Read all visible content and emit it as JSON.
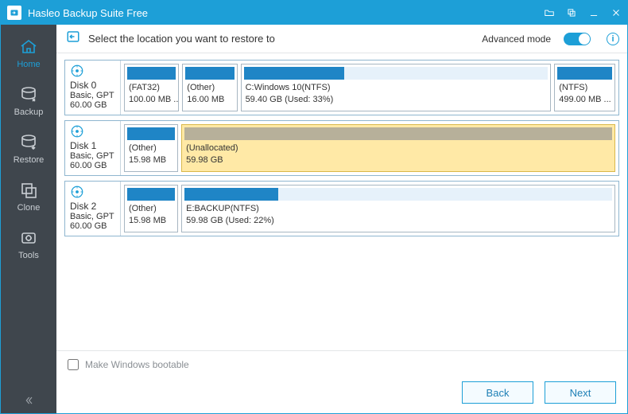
{
  "app": {
    "title": "Hasleo Backup Suite Free"
  },
  "sidebar": {
    "items": [
      {
        "label": "Home"
      },
      {
        "label": "Backup"
      },
      {
        "label": "Restore"
      },
      {
        "label": "Clone"
      },
      {
        "label": "Tools"
      }
    ]
  },
  "header": {
    "prompt": "Select the location you want to restore to",
    "advanced_label": "Advanced mode",
    "toggle_on": true
  },
  "disks": [
    {
      "name": "Disk 0",
      "type": "Basic, GPT",
      "size": "60.00 GB",
      "partitions": [
        {
          "label": "(FAT32)",
          "size": "100.00 MB ...",
          "flex": 0.9,
          "fill": 100
        },
        {
          "label": "(Other)",
          "size": "16.00 MB",
          "flex": 0.9,
          "fill": 100
        },
        {
          "label": "C:Windows 10(NTFS)",
          "size": "59.40 GB (Used: 33%)",
          "flex": 5.2,
          "fill": 33
        },
        {
          "label": "(NTFS)",
          "size": "499.00 MB ...",
          "flex": 1.0,
          "fill": 100
        }
      ]
    },
    {
      "name": "Disk 1",
      "type": "Basic, GPT",
      "size": "60.00 GB",
      "partitions": [
        {
          "label": "(Other)",
          "size": "15.98 MB",
          "flex": 0.9,
          "fill": 100
        },
        {
          "label": "(Unallocated)",
          "size": "59.98 GB",
          "flex": 7.4,
          "fill": 100,
          "selected": true
        }
      ]
    },
    {
      "name": "Disk 2",
      "type": "Basic, GPT",
      "size": "60.00 GB",
      "partitions": [
        {
          "label": "(Other)",
          "size": "15.98 MB",
          "flex": 0.9,
          "fill": 100
        },
        {
          "label": "E:BACKUP(NTFS)",
          "size": "59.98 GB (Used: 22%)",
          "flex": 7.4,
          "fill": 22
        }
      ]
    }
  ],
  "footer": {
    "checkbox_label": "Make Windows bootable",
    "back_label": "Back",
    "next_label": "Next"
  }
}
